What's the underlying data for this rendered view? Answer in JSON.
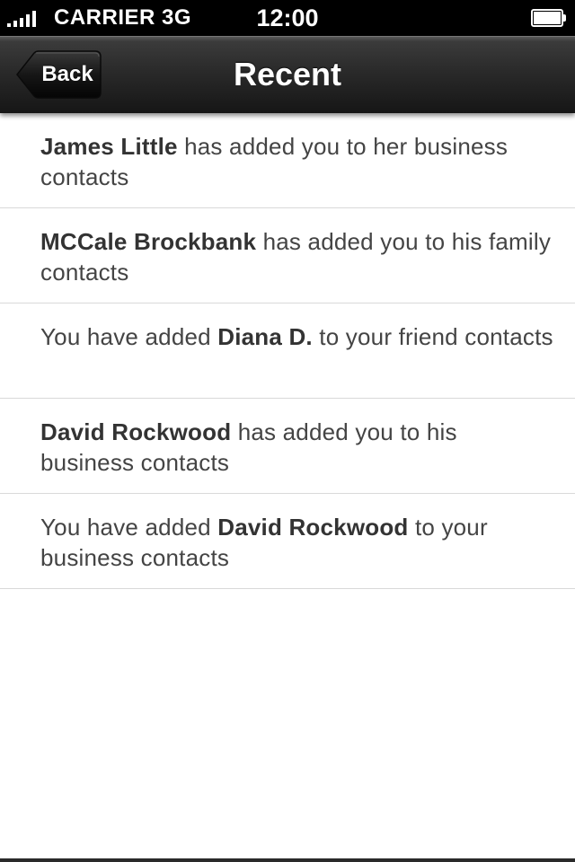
{
  "status_bar": {
    "carrier": "CARRIER",
    "network": "3G",
    "time": "12:00",
    "signal_bars": 5,
    "battery_level": 1.0
  },
  "nav": {
    "back_label": "Back",
    "title": "Recent"
  },
  "activity": [
    {
      "before": "",
      "bold": "James Little",
      "after": " has added you to her business contacts"
    },
    {
      "before": "",
      "bold": "MCCale Brockbank",
      "after": " has added you to his family contacts"
    },
    {
      "before": "You have added ",
      "bold": "Diana D.",
      "after": " to your friend contacts"
    },
    {
      "before": "",
      "bold": "David Rockwood",
      "after": " has added you to his business contacts"
    },
    {
      "before": "You have added ",
      "bold": "David Rockwood",
      "after": " to your business contacts"
    }
  ],
  "colors": {
    "nav_bar": "#2a2a2a",
    "status_bar": "#000000",
    "list_text": "#444444",
    "separator": "#d9d9d9"
  },
  "icons": {
    "signal": "signal-strength-icon",
    "battery": "battery-icon",
    "back": "back-arrow-button"
  }
}
